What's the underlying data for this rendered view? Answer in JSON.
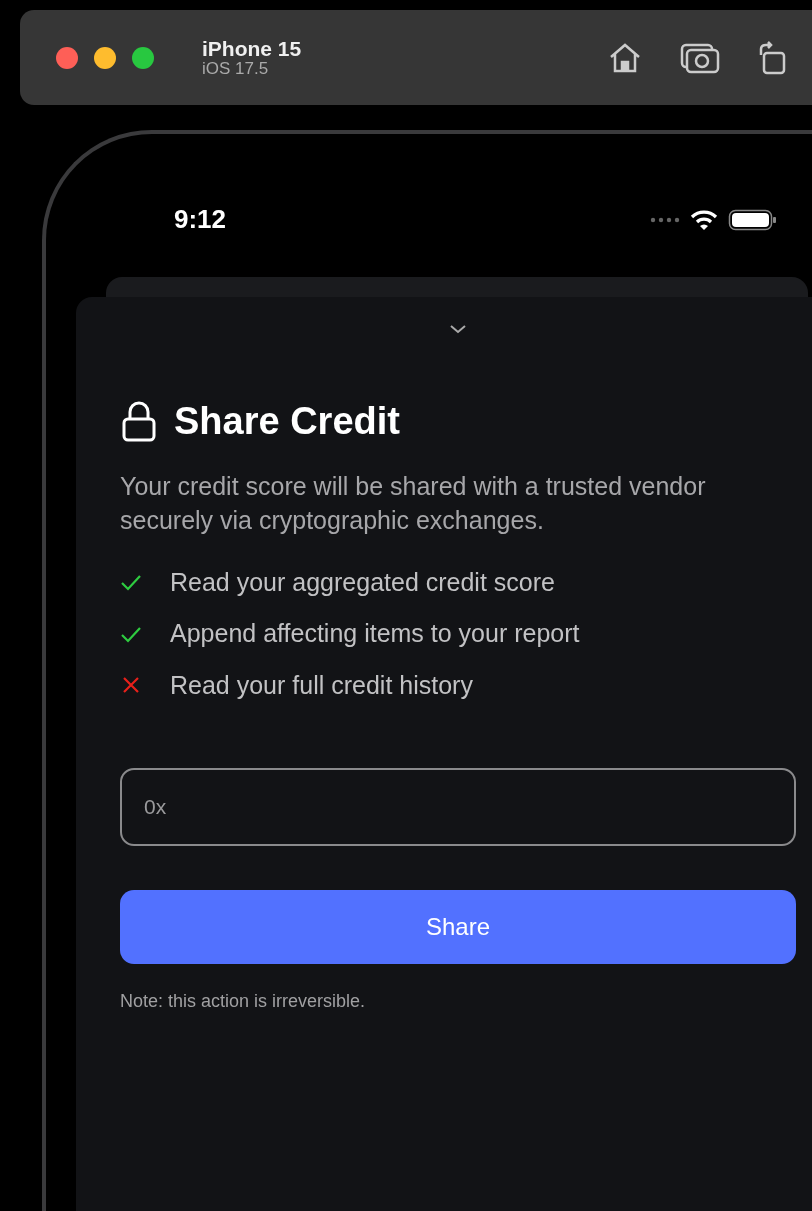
{
  "simulator": {
    "device": "iPhone 15",
    "os": "iOS 17.5"
  },
  "status_bar": {
    "time": "9:12"
  },
  "sheet": {
    "title": "Share Credit",
    "description": "Your credit score will be shared with a trusted vendor securely via cryptographic exchanges.",
    "permissions": [
      {
        "label": "Read your aggregated credit score",
        "allowed": true
      },
      {
        "label": "Append affecting items to your report",
        "allowed": true
      },
      {
        "label": "Read your full credit history",
        "allowed": false
      }
    ],
    "address_field": {
      "placeholder": "0x"
    },
    "button": "Share",
    "note": "Note: this action is irreversible."
  }
}
